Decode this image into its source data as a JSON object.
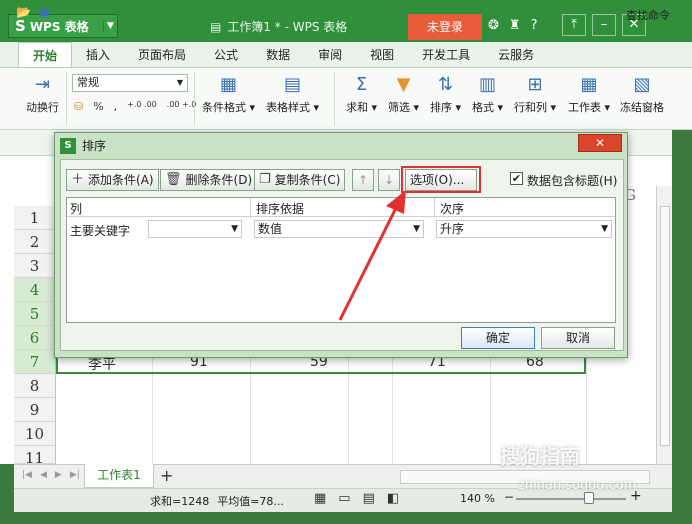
{
  "app": {
    "logo": "S",
    "name": "WPS 表格",
    "document_title": "工作簿1 * - WPS 表格",
    "login_label": "未登录",
    "help_label": "?"
  },
  "ribbon_tabs": [
    "开始",
    "插入",
    "页面布局",
    "公式",
    "数据",
    "审阅",
    "视图",
    "开发工具",
    "云服务"
  ],
  "ribbon": {
    "wrap_label": "动换行",
    "number_format": "常规",
    "percent": "%",
    "comma": ",",
    "dec_inc": "+.0 .00",
    "dec_dec": ".00 +.0",
    "cond_format": "条件格式",
    "table_style": "表格样式",
    "sum": "求和",
    "filter": "筛选",
    "sort": "排序",
    "format": "格式",
    "row_col": "行和列",
    "worksheet": "工作表",
    "freeze": "冻结窗格",
    "find_cmd": "查找命令"
  },
  "sheet": {
    "rows": [
      "1",
      "2",
      "3",
      "4",
      "5",
      "6",
      "7",
      "8",
      "9",
      "10",
      "11"
    ],
    "col_g": "G",
    "row7": [
      "李平",
      "91",
      "59",
      "71",
      "68"
    ],
    "tab_name": "工作表1",
    "add_sheet": "+"
  },
  "status": {
    "sum": "求和=1248",
    "avg": "平均值=78...",
    "zoom": "140 %",
    "zoom_minus": "−",
    "zoom_plus": "+"
  },
  "dialog": {
    "logo": "S",
    "title": "排序",
    "add_condition": "添加条件(A)",
    "delete_condition": "删除条件(D)",
    "copy_condition": "复制条件(C)",
    "move_up": "↑",
    "move_down": "↓",
    "options": "选项(O)...",
    "has_header_label": "数据包含标题(H)",
    "has_header_checked": true,
    "columns": [
      "列",
      "排序依据",
      "次序"
    ],
    "row": {
      "key_label": "主要关键字",
      "column_value": "",
      "sort_on": "数值",
      "order": "升序"
    },
    "ok": "确定",
    "cancel": "取消"
  },
  "watermark": {
    "brand": "搜狗指南",
    "url": "zhinan.sogou.com"
  },
  "colors": {
    "title_green": "#2f8f3b",
    "login_orange": "#e85c3a",
    "highlight_red": "#e23030"
  }
}
